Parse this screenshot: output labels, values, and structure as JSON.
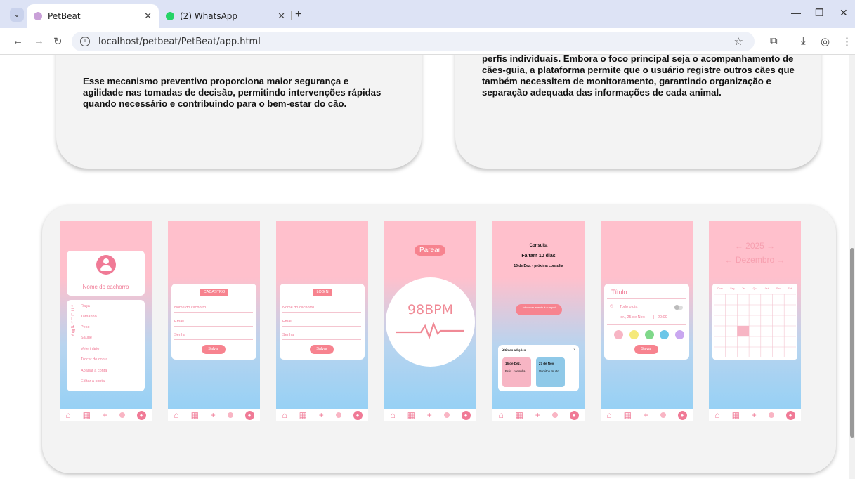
{
  "browser": {
    "tabs": [
      {
        "title": "PetBeat",
        "active": true
      },
      {
        "title": "(2) WhatsApp",
        "active": false
      }
    ],
    "url": "localhost/petbeat/PetBeat/app.html"
  },
  "cards": {
    "left_text": "Esse mecanismo preventivo proporciona maior segurança e agilidade nas tomadas de decisão, permitindo intervenções rápidas quando necessário e contribuindo para o bem-estar do cão.",
    "right_text": "perfis individuais. Embora o foco principal seja o acompanhamento de cães-guia, a plataforma permite que o usuário registre outros cães que também necessitem de monitoramento, garantindo organização e separação adequada das informações de cada animal."
  },
  "screens": {
    "profile": {
      "dog_name": "Nome do cachorro",
      "menu": [
        "Raça",
        "Tamanho",
        "Peso",
        "Saúde",
        "Veterinário",
        "Trocar de conta",
        "Apagar a conta",
        "Editar a conta"
      ]
    },
    "register": {
      "title": "CADASTRO",
      "fields": [
        "Nome do cachorro",
        "Email",
        "Senha"
      ],
      "button": "Salvar"
    },
    "login": {
      "title": "LOGIN",
      "fields": [
        "Nome do cachorro",
        "Email",
        "Senha"
      ],
      "button": "Salvar"
    },
    "heart": {
      "pair_button": "Parear",
      "bpm": "98BPM"
    },
    "appointment": {
      "label": "Consulta",
      "remaining": "Faltam 10 dias",
      "next": "16 de Dez. - próxima consulta",
      "add_button": "Adicionar evento à sua pet",
      "recent_title": "Últimas adições",
      "recent": [
        {
          "date": "16 de Dez.",
          "desc": "Próx. consulta"
        },
        {
          "date": "27 de Nov.",
          "desc": "Vomitou muito"
        }
      ]
    },
    "event": {
      "title": "Título",
      "all_day": "Todo o dia",
      "date": "lor., 25 de Nov.",
      "time": "20:00",
      "button": "Salvar",
      "colors": [
        "#f7b5c4",
        "#f5e97a",
        "#7fd88a",
        "#6cc6e8",
        "#c9a7f0"
      ]
    },
    "calendar": {
      "year": "← 2025 →",
      "month": "← Dezembro →",
      "weekdays": [
        "Dom",
        "Seg",
        "Ter",
        "Qua",
        "Qui",
        "Sex",
        "Sáb"
      ]
    }
  }
}
